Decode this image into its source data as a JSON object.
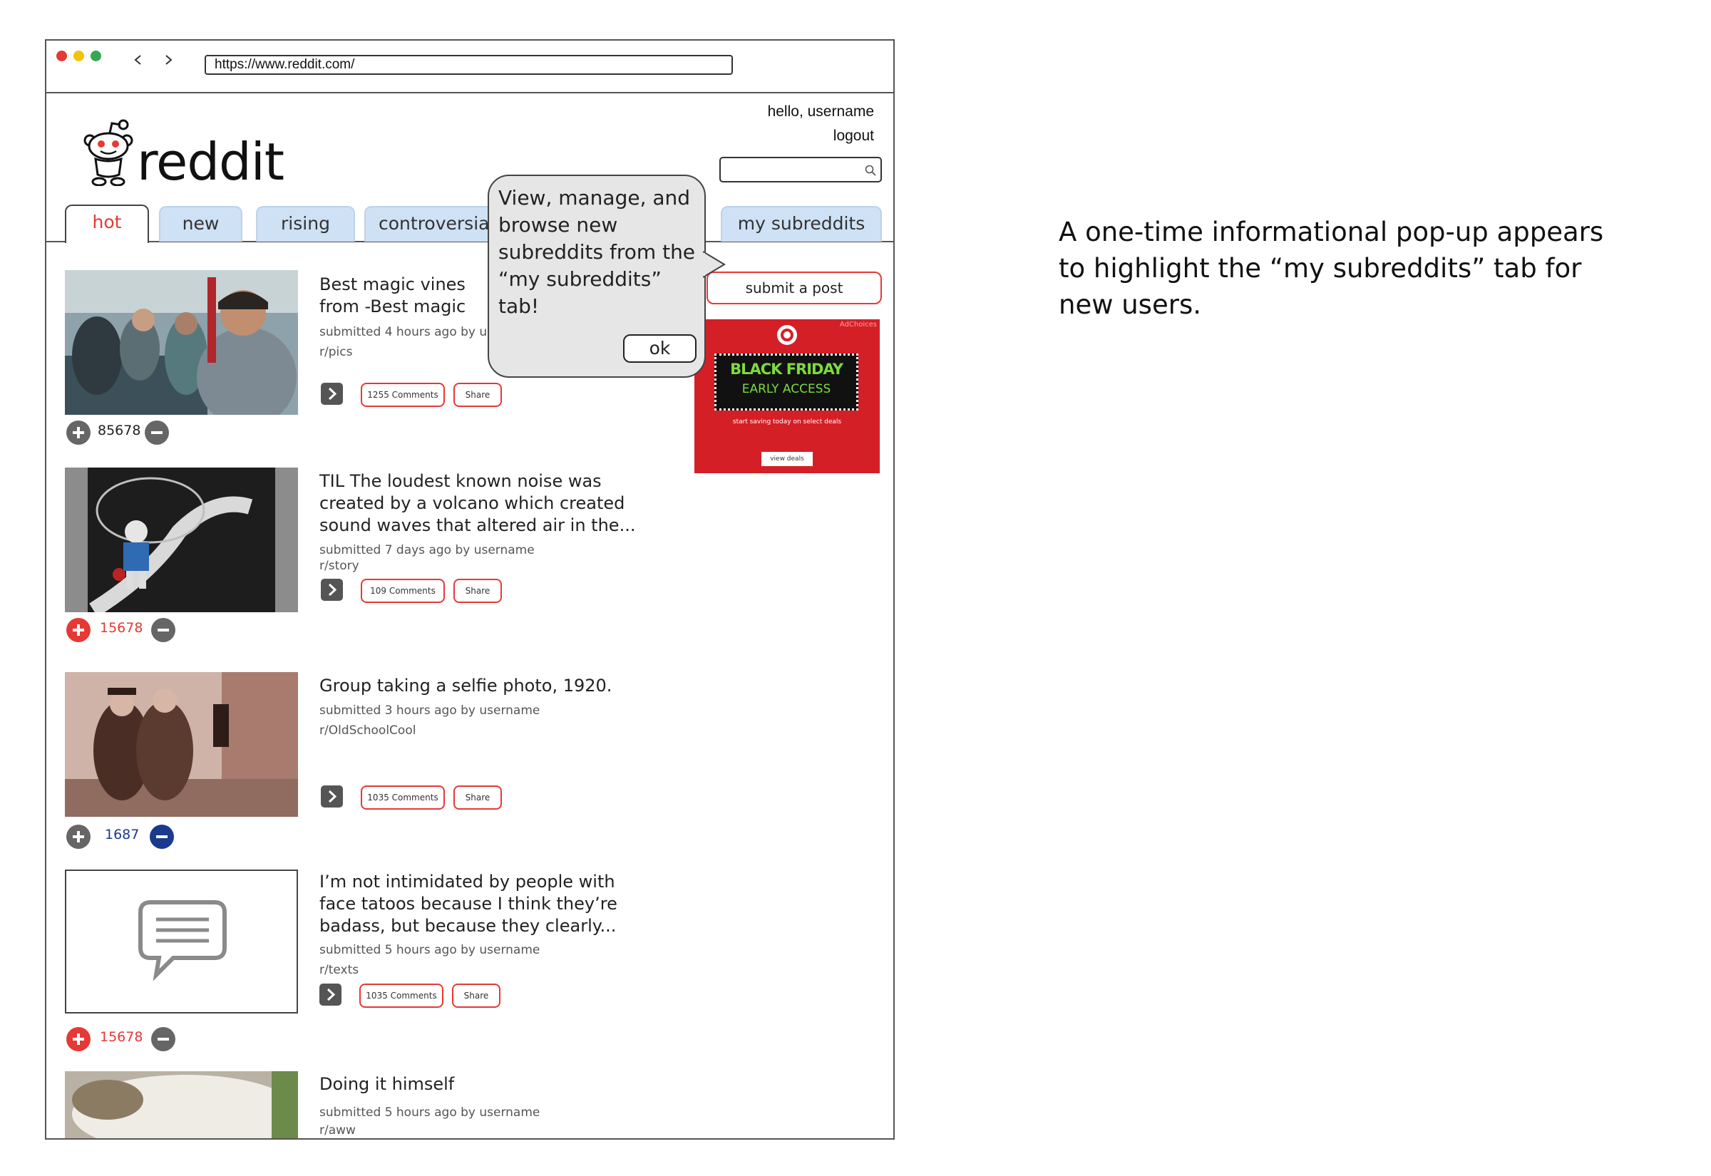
{
  "browser": {
    "url": "https://www.reddit.com/",
    "traffic_lights": [
      "#e53935",
      "#f4c20d",
      "#34a853"
    ]
  },
  "header": {
    "logo_text": "reddit",
    "greeting": "hello, username",
    "logout_label": "logout",
    "search_placeholder": ""
  },
  "tabs": [
    {
      "label": "hot",
      "active": true
    },
    {
      "label": "new",
      "active": false
    },
    {
      "label": "rising",
      "active": false
    },
    {
      "label": "controversial",
      "active": false
    },
    {
      "label": "my subreddits",
      "active": false
    }
  ],
  "posts": [
    {
      "title": "Best magic vines from -Best magic tricks ev",
      "submitted": "submitted 4 hours ago by use",
      "subreddit": "r/pics",
      "comments_label": "1255 Comments",
      "share_label": "Share",
      "votes": "85678",
      "vote_state": "none"
    },
    {
      "title": "TIL The loudest known noise was created by a volcano which created sound waves that altered air in the...",
      "submitted": "submitted 7 days ago by username",
      "subreddit": "r/story",
      "comments_label": "109 Comments",
      "share_label": "Share",
      "votes": "15678",
      "vote_state": "up"
    },
    {
      "title": "Group taking a selfie photo, 1920.",
      "submitted": "submitted 3 hours ago by username",
      "subreddit": "r/OldSchoolCool",
      "comments_label": "1035 Comments",
      "share_label": "Share",
      "votes": "1687",
      "vote_state": "down"
    },
    {
      "title": "I’m not intimidated by people with face tatoos because I think they’re badass, but because they clearly...",
      "submitted": "submitted 5  hours ago by username",
      "subreddit": "r/texts",
      "comments_label": "1035 Comments",
      "share_label": "Share",
      "votes": "15678",
      "vote_state": "up"
    },
    {
      "title": "Doing it himself",
      "submitted": "submitted 5 hours ago by username",
      "subreddit": "r/aww"
    }
  ],
  "sidebar": {
    "submit_label": "submit a post",
    "ad": {
      "choices_label": "AdChoices",
      "headline": "BLACK FRIDAY",
      "subheadline": "EARLY ACCESS",
      "tagline": "start saving today on select deals",
      "cta": "view deals"
    }
  },
  "popup": {
    "message": "View, manage, and browse new subreddits from the “my subreddits” tab!",
    "ok_label": "ok"
  },
  "caption": "A one-time informational pop-up appears to highlight the “my subreddits” tab for new users.",
  "colors": {
    "accent_red": "#e53935",
    "tab_blue": "#cfe1f4",
    "downvote_blue": "#1a3a8f",
    "neutral_gray": "#666666"
  }
}
